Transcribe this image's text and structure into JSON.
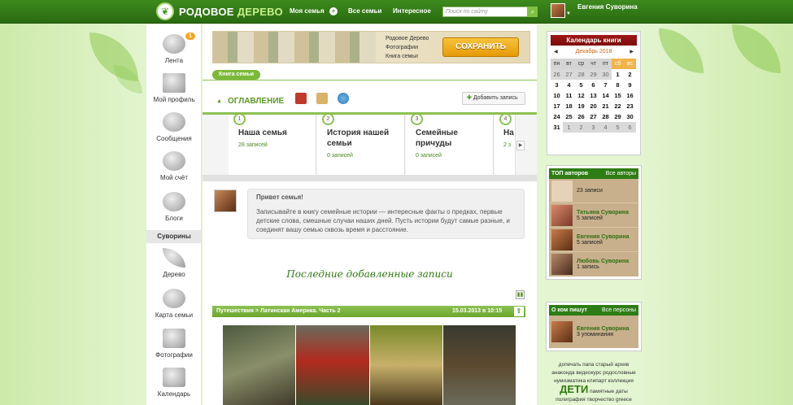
{
  "topbar": {
    "logo_part1": "РОДОВОЕ",
    "logo_part2": "ДЕРЕВО",
    "nav_my_family": "Моя семья",
    "nav_all_families": "Все семьи",
    "nav_interesting": "Интересное",
    "search_placeholder": "Поиск по сайту",
    "user_name": "Евгения Суворина"
  },
  "leftbar": {
    "items": [
      {
        "label": "Лента",
        "badge": "1"
      },
      {
        "label": "Мой профиль"
      },
      {
        "label": "Сообщения"
      },
      {
        "label": "Мой счёт"
      },
      {
        "label": "Блоги"
      },
      {
        "label": "Дерево"
      },
      {
        "label": "Карта семьи"
      },
      {
        "label": "Фотографии"
      },
      {
        "label": "Календарь"
      }
    ],
    "section_label": "Суворины"
  },
  "banner": {
    "line1": "Родовое Дерево",
    "line2": "Фотографии",
    "line3": "Книга семьи",
    "save_label": "СОХРАНИТЬ"
  },
  "book_tab": "Книга семьи",
  "toc": {
    "title": "ОГЛАВЛЕНИЕ",
    "add_label": "Добавить запись",
    "cards": [
      {
        "num": "1",
        "name": "Наша семья",
        "count": "28 записей"
      },
      {
        "num": "2",
        "name": "История нашей семьи",
        "count": "0 записей"
      },
      {
        "num": "3",
        "name": "Семейные причуды",
        "count": "0 записей"
      },
      {
        "num": "4",
        "name": "На",
        "count": "2 з"
      }
    ]
  },
  "greeting": {
    "title": "Привет семья!",
    "text": "Записывайте в книгу семейные истории — интересные факты о предках, первые детские слова, смешные случаи наших дней. Пусть истории будут самые разные, и соединят вашу семью сквозь время и расстояние."
  },
  "recent_title": "Последние добавленные записи",
  "entry": {
    "path": "Путешествия  >  Латинская Америка. Часть 2",
    "date": "15.03.2013 в 10:15"
  },
  "calendar": {
    "title": "Календарь книги",
    "month": "Декабрь 2018",
    "weekdays": [
      "пн",
      "вт",
      "ср",
      "чт",
      "пт",
      "сб",
      "вс"
    ],
    "weekend_index": [
      5,
      6
    ],
    "days": [
      {
        "d": "26",
        "p": true
      },
      {
        "d": "27",
        "p": true
      },
      {
        "d": "28",
        "p": true
      },
      {
        "d": "29",
        "p": true
      },
      {
        "d": "30",
        "p": true
      },
      {
        "d": "1",
        "p": false
      },
      {
        "d": "2",
        "p": false
      },
      {
        "d": "3",
        "p": false
      },
      {
        "d": "4",
        "p": false
      },
      {
        "d": "5",
        "p": false
      },
      {
        "d": "6",
        "p": false
      },
      {
        "d": "7",
        "p": false
      },
      {
        "d": "8",
        "p": false
      },
      {
        "d": "9",
        "p": false
      },
      {
        "d": "10",
        "p": false
      },
      {
        "d": "11",
        "p": false
      },
      {
        "d": "12",
        "p": false
      },
      {
        "d": "13",
        "p": false
      },
      {
        "d": "14",
        "p": false
      },
      {
        "d": "15",
        "p": false
      },
      {
        "d": "16",
        "p": false
      },
      {
        "d": "17",
        "p": false
      },
      {
        "d": "18",
        "p": false
      },
      {
        "d": "19",
        "p": false
      },
      {
        "d": "20",
        "p": false
      },
      {
        "d": "21",
        "p": false
      },
      {
        "d": "22",
        "p": false
      },
      {
        "d": "23",
        "p": false
      },
      {
        "d": "24",
        "p": false
      },
      {
        "d": "25",
        "p": false
      },
      {
        "d": "26",
        "p": false
      },
      {
        "d": "27",
        "p": false
      },
      {
        "d": "28",
        "p": false
      },
      {
        "d": "29",
        "p": false
      },
      {
        "d": "30",
        "p": false
      },
      {
        "d": "31",
        "p": false
      },
      {
        "d": "1",
        "p": true
      },
      {
        "d": "2",
        "p": true
      },
      {
        "d": "3",
        "p": true
      },
      {
        "d": "4",
        "p": true
      },
      {
        "d": "5",
        "p": true
      },
      {
        "d": "6",
        "p": true
      }
    ]
  },
  "top_authors": {
    "title": "ТОП авторов",
    "link": "Все авторы",
    "rows": [
      {
        "name": "",
        "count": "23 записи"
      },
      {
        "name": "Татьяна Суворина",
        "count": "5 записей"
      },
      {
        "name": "Евгения Суворина",
        "count": "5 записей"
      },
      {
        "name": "Любовь Суворина",
        "count": "1 запись"
      }
    ]
  },
  "mentions": {
    "title": "О ком пишут",
    "link": "Все персоны",
    "rows": [
      {
        "name": "Евгения Суворина",
        "count": "3 упоминания"
      }
    ]
  },
  "tags": {
    "line1": "допечать папа старый архив",
    "line2": "анаконда видеокурс родословные",
    "line3": "нумизматика клипарт коллекция",
    "big": "ДЕТИ",
    "big_suffix": "памятные даты",
    "line5": "полиграфия творчество greece"
  }
}
